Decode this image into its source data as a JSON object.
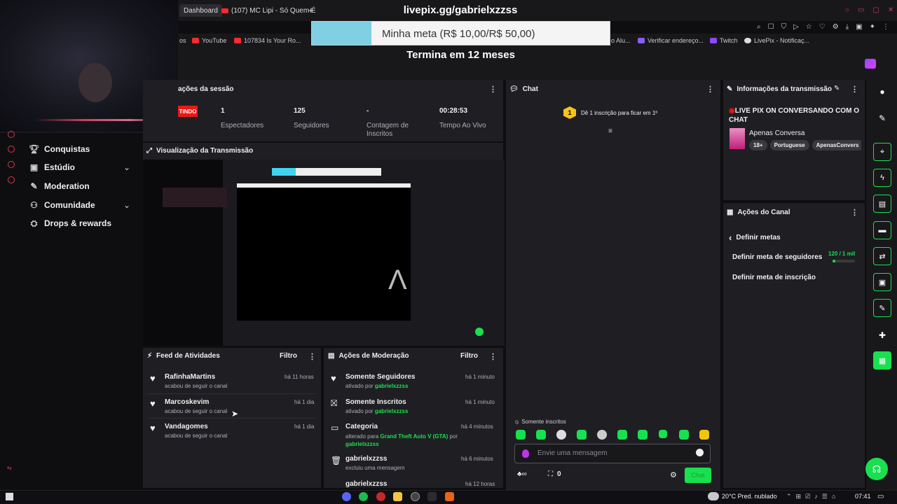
{
  "browser": {
    "tabs": [
      {
        "label": "Dashboard",
        "active": true
      },
      {
        "label": "(107) MC Lipi - Só Quem É",
        "active": false
      }
    ],
    "new_tab": "+",
    "bookmarks": [
      "os",
      "YouTube",
      "107834 Is Your Ro...",
      "o Alu...",
      "Verificar endereço...",
      "Twitch",
      "LivePix - Notificaç..."
    ]
  },
  "overlay": {
    "url": "livepix.gg/gabrielxzzss",
    "goal_text": "Minha meta (R$ 10,00/R$ 50,00)",
    "goal_progress": 0.2,
    "ends_in": "Termina em 12 meses"
  },
  "nav": {
    "items": [
      {
        "label": "Conquistas",
        "icon": "trophy-icon"
      },
      {
        "label": "Estúdio",
        "icon": "studio-icon"
      },
      {
        "label": "Moderation",
        "icon": "wrench-icon"
      },
      {
        "label": "Comunidade",
        "icon": "community-icon"
      },
      {
        "label": "Drops & rewards",
        "icon": "gift-icon"
      }
    ]
  },
  "session": {
    "title": "ações da sessão",
    "live_badge": "TINDO",
    "stats": [
      {
        "value": "1",
        "label": "Espectadores"
      },
      {
        "value": "125",
        "label": "Seguidores"
      },
      {
        "value": "-",
        "label": "Contagem de Inscritos"
      },
      {
        "value": "00:28:53",
        "label": "Tempo Ao Vivo"
      }
    ]
  },
  "preview": {
    "title": "Visualização da Transmissão"
  },
  "activity": {
    "title": "Feed de Atividades",
    "filter": "Filtro",
    "items": [
      {
        "name": "RafinhaMartins",
        "action": "acabou de seguir o canal",
        "time": "há 11 horas"
      },
      {
        "name": "Marcoskevim",
        "action": "acabou de seguir o canal",
        "time": "há 1 dia"
      },
      {
        "name": "Vandagomes",
        "action": "acabou de seguir o canal",
        "time": "há 1 dia"
      }
    ]
  },
  "moderation": {
    "title": "Ações de Moderação",
    "filter": "Filtro",
    "items": [
      {
        "title": "Somente Seguidores",
        "pre": "ativado por",
        "highlight": "gabrielxzzss",
        "time": "há 1 minuto"
      },
      {
        "title": "Somente Inscritos",
        "pre": "ativado por",
        "highlight": "gabrielxzzss",
        "time": "há 1 minuto"
      },
      {
        "title": "Categoria",
        "pre": "alterado para",
        "highlight": "Grand Theft Auto V (GTA)",
        "post": "por",
        "highlight2": "gabrielxzzss",
        "time": "há 4 minutos"
      },
      {
        "title": "gabrielxzzss",
        "pre": "excluiu uma mensagem",
        "time": "há 6 minutos"
      },
      {
        "title": "gabrielxzzss",
        "time": "há 12 horas"
      }
    ]
  },
  "chat": {
    "title": "Chat",
    "sub_badge": "1",
    "sub_prompt": "Dê 1 inscrição para ficar em 1º",
    "mode_label": "Somente inscritos",
    "input_placeholder": "Envie uma mensagem",
    "points": "0",
    "send_label": "Chat"
  },
  "stream_info": {
    "title": "Informações da transmissão",
    "stream_title": "LIVE PIX ON CONVERSANDO COM O CHAT",
    "category": "Apenas Conversa",
    "tags": [
      "18+",
      "Portuguese",
      "ApenasConvers"
    ]
  },
  "channel_actions": {
    "title": "Ações do Canal",
    "back_label": "Definir metas",
    "goals": [
      {
        "label": "Definir meta de seguidores",
        "value": "120 / 1 mil",
        "progress": 0.12
      },
      {
        "label": "Definir meta de inscrição"
      }
    ]
  },
  "taskbar": {
    "weather": "20°C  Pred. nublado",
    "time": "07:41"
  },
  "colors": {
    "accent": "#19e04f",
    "live": "#e91916",
    "bg": "#0e0e10",
    "panel": "#1f1f23"
  }
}
